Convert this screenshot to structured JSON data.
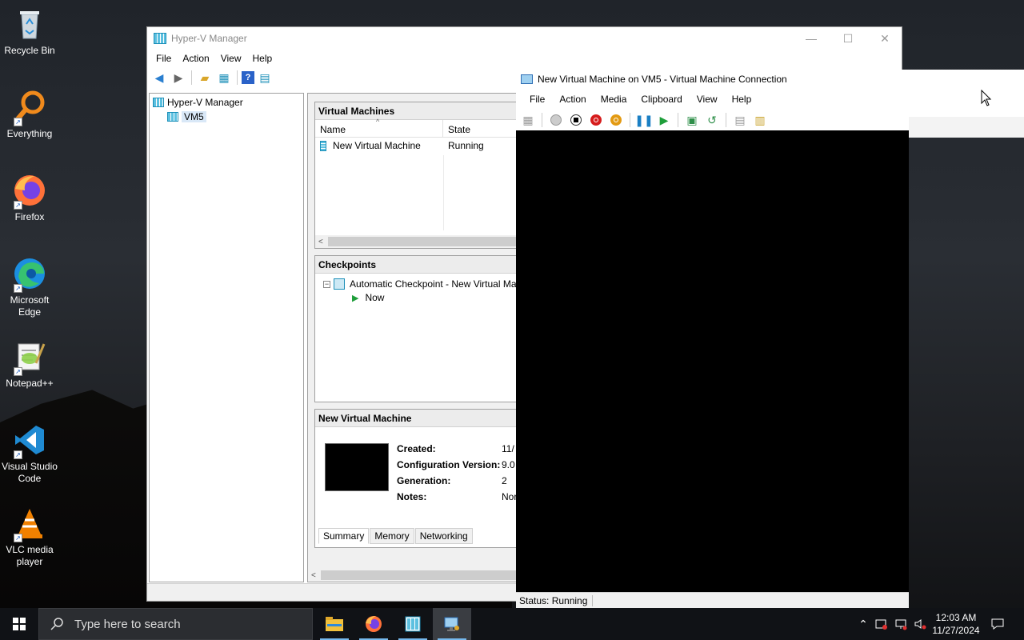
{
  "desktop": {
    "icons": [
      {
        "label": "Recycle Bin"
      },
      {
        "label": "Everything"
      },
      {
        "label": "Firefox"
      },
      {
        "label": "Microsoft Edge"
      },
      {
        "label": "Notepad++"
      },
      {
        "label": "Visual Studio Code"
      },
      {
        "label": "VLC media player"
      }
    ]
  },
  "hyperv": {
    "title": "Hyper-V Manager",
    "menu": [
      "File",
      "Action",
      "View",
      "Help"
    ],
    "tree": {
      "root": "Hyper-V Manager",
      "server": "VM5"
    },
    "vms": {
      "header": "Virtual Machines",
      "columns": {
        "name": "Name",
        "state": "State"
      },
      "rows": [
        {
          "name": "New Virtual Machine",
          "state": "Running"
        }
      ]
    },
    "checkpoints": {
      "header": "Checkpoints",
      "items": [
        {
          "label": "Automatic Checkpoint - New Virtual Machin"
        },
        {
          "label": "Now"
        }
      ]
    },
    "details": {
      "header": "New Virtual Machine",
      "created_label": "Created:",
      "created_value": "11/",
      "config_label": "Configuration Version:",
      "config_value": "9.0",
      "gen_label": "Generation:",
      "gen_value": "2",
      "notes_label": "Notes:",
      "notes_value": "Nor",
      "tabs": [
        "Summary",
        "Memory",
        "Networking"
      ]
    }
  },
  "vmconnect": {
    "title": "New Virtual Machine on VM5 - Virtual Machine Connection",
    "menu": [
      "File",
      "Action",
      "Media",
      "Clipboard",
      "View",
      "Help"
    ],
    "status": "Status: Running"
  },
  "taskbar": {
    "search_placeholder": "Type here to search",
    "time": "12:03 AM",
    "date": "11/27/2024"
  }
}
